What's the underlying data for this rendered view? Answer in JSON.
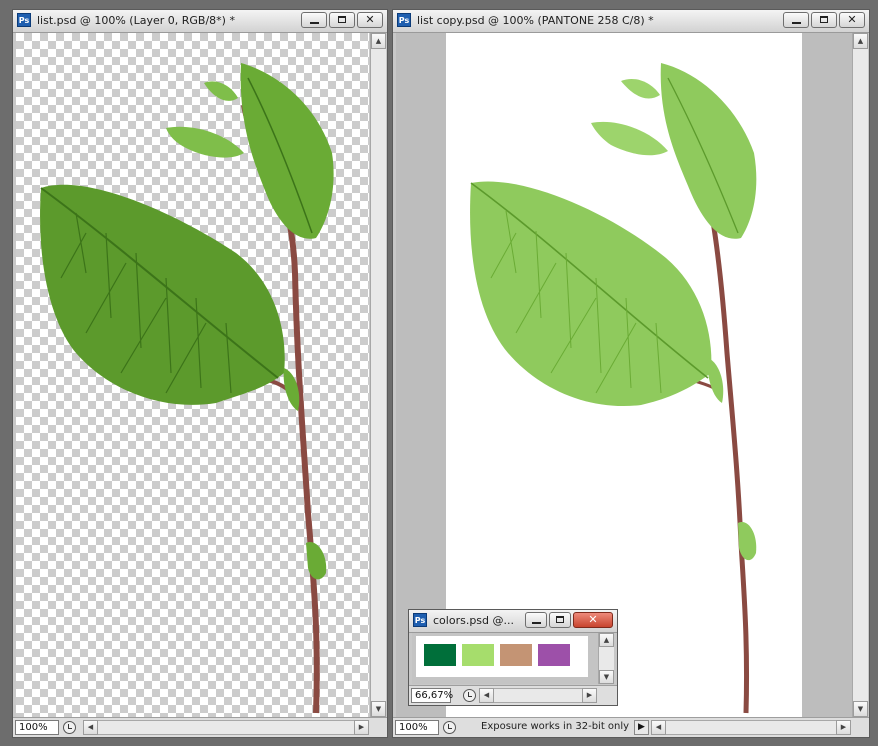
{
  "windows": {
    "list": {
      "title": "list.psd @ 100% (Layer 0, RGB/8*) *",
      "zoom": "100%"
    },
    "list_copy": {
      "title": "list copy.psd @ 100% (PANTONE 258 C/8) *",
      "zoom": "100%",
      "status_message": "Exposure works in 32-bit only"
    },
    "colors": {
      "title": "colors.psd @...",
      "zoom": "66,67%",
      "swatches": [
        {
          "color": "#006f3a"
        },
        {
          "color": "#a6dd6c"
        },
        {
          "color": "#c49474"
        },
        {
          "color": "#9d50a9"
        }
      ]
    }
  },
  "icons": {
    "app": "photoshop-icon",
    "minimize": "minimize-icon",
    "maximize": "maximize-icon",
    "close": "close-icon"
  },
  "glyphs": {
    "app_badge": "Ps",
    "close": "✕",
    "up": "▲",
    "down": "▼",
    "left": "◀",
    "right": "▶",
    "play": "▶"
  },
  "colors": {
    "leaf_green": "#5c9a2c",
    "leaf_light": "#8fca5d",
    "stem": "#8a4a42"
  }
}
